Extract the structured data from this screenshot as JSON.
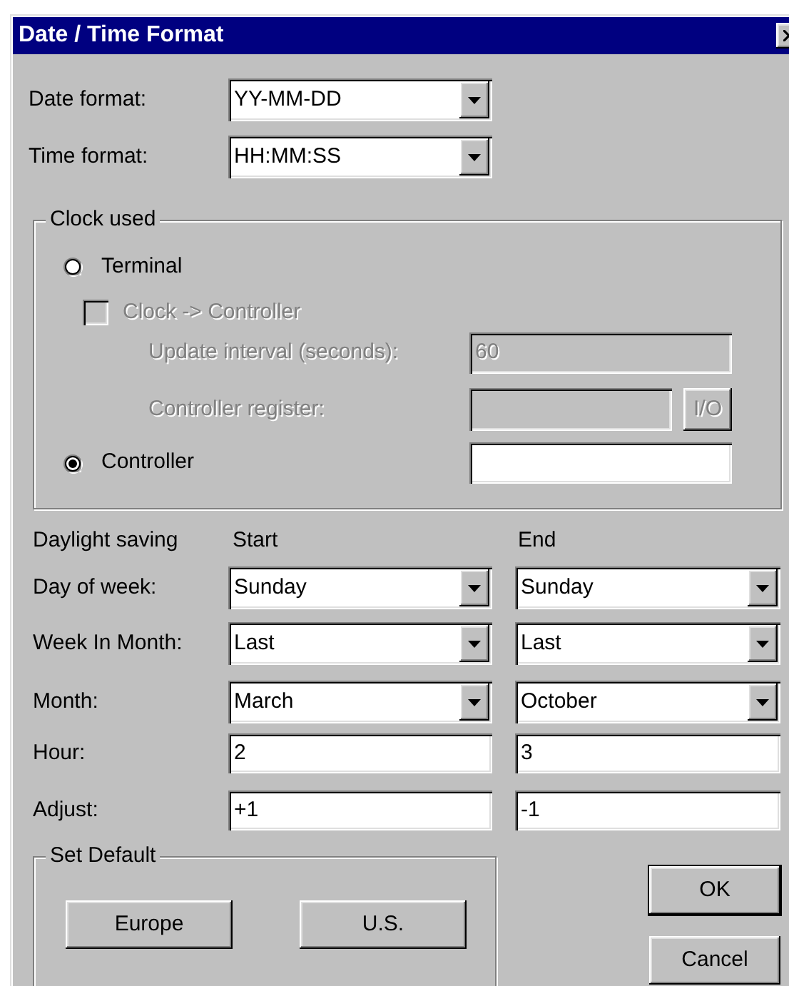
{
  "window": {
    "title": "Date / Time Format"
  },
  "format_fields": [
    {
      "label": "Date format:",
      "value": "YY-MM-DD"
    },
    {
      "label": "Time format:",
      "value": "HH:MM:SS"
    }
  ],
  "clock_used": {
    "title": "Clock used",
    "items": [
      {
        "kind": "radio",
        "label": "Terminal",
        "selected": false,
        "disabled": false
      },
      {
        "kind": "checkbox",
        "label": "Clock -> Controller",
        "checked": false,
        "disabled": true
      },
      {
        "kind": "field",
        "label": "Update interval (seconds):",
        "value": "60",
        "disabled": true
      },
      {
        "kind": "field_button",
        "label": "Controller register:",
        "button": "I/O",
        "disabled": true
      },
      {
        "kind": "radio_field",
        "label": "Controller",
        "selected": true,
        "disabled": false
      }
    ]
  },
  "daylight_saving": {
    "title": "Daylight saving",
    "columns": [
      "Start",
      "End"
    ],
    "rows": [
      {
        "kind": "combo",
        "label": "Day of week:",
        "values": [
          "Sunday",
          "Sunday"
        ]
      },
      {
        "kind": "combo",
        "label": "Week In Month:",
        "values": [
          "Last",
          "Last"
        ]
      },
      {
        "kind": "combo",
        "label": "Month:",
        "values": [
          "March",
          "October"
        ]
      },
      {
        "kind": "field",
        "label": "Hour:",
        "values": [
          "2",
          "3"
        ]
      },
      {
        "kind": "field",
        "label": "Adjust:",
        "values": [
          "+1",
          "-1"
        ]
      }
    ]
  },
  "set_default": {
    "title": "Set Default",
    "buttons": [
      "Europe",
      "U.S."
    ]
  },
  "buttons": [
    {
      "label": "OK",
      "default": true
    },
    {
      "label": "Cancel",
      "default": false
    }
  ]
}
